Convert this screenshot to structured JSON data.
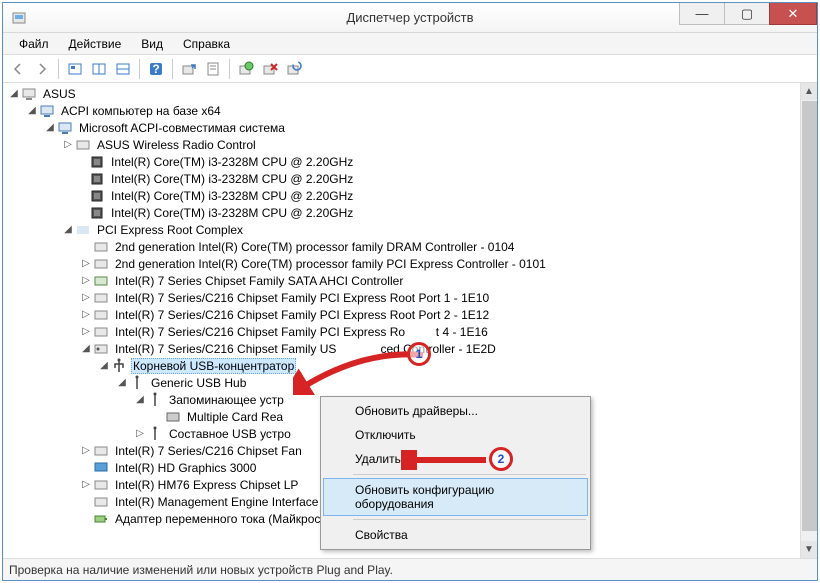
{
  "window": {
    "title": "Диспетчер устройств"
  },
  "menu": {
    "file": "Файл",
    "action": "Действие",
    "view": "Вид",
    "help": "Справка"
  },
  "tree": {
    "root": "ASUS",
    "n1": "ACPI компьютер на базе x64",
    "n2": "Microsoft ACPI-совместимая система",
    "wireless": "ASUS Wireless Radio Control",
    "cpu1": "Intel(R) Core(TM) i3-2328M CPU @ 2.20GHz",
    "cpu2": "Intel(R) Core(TM) i3-2328M CPU @ 2.20GHz",
    "cpu3": "Intel(R) Core(TM) i3-2328M CPU @ 2.20GHz",
    "cpu4": "Intel(R) Core(TM) i3-2328M CPU @ 2.20GHz",
    "pci": "PCI Express Root Complex",
    "dram": "2nd generation Intel(R) Core(TM) processor family DRAM Controller - 0104",
    "pcictl": "2nd generation Intel(R) Core(TM) processor family PCI Express Controller - 0101",
    "sata": "Intel(R) 7 Series Chipset Family SATA AHCI Controller",
    "rp1": "Intel(R) 7 Series/C216 Chipset Family PCI Express Root Port 1 - 1E10",
    "rp2": "Intel(R) 7 Series/C216 Chipset Family PCI Express Root Port 2 - 1E12",
    "rp4_a": "Intel(R) 7 Series/C216 Chipset Family PCI Express Ro",
    "rp4_b": "t 4 - 1E16",
    "usbctl_a": "Intel(R) 7 Series/C216 Chipset Family US",
    "usbctl_b": "ced Controller - 1E2D",
    "usbhub": "Корневой USB-концентратор",
    "generic": "Generic USB Hub",
    "storage": "Запоминающее устр",
    "cardreader": "Multiple Card  Rea",
    "composite": "Составное USB устро",
    "chipfam": "Intel(R) 7 Series/C216 Chipset Fan",
    "hd3000": "Intel(R) HD Graphics 3000",
    "lpc": "Intel(R) HM76 Express Chipset LP",
    "mei": "Intel(R) Management Engine Interface",
    "adapter": "Адаптер переменного тока (Майкрософт)"
  },
  "context_menu": {
    "update": "Обновить драйверы...",
    "disable": "Отключить",
    "delete": "Удалить",
    "scan": "Обновить конфигурацию оборудования",
    "props": "Свойства"
  },
  "status": "Проверка на наличие изменений или новых устройств Plug and Play.",
  "annotations": {
    "b1": "1",
    "b2": "2"
  }
}
